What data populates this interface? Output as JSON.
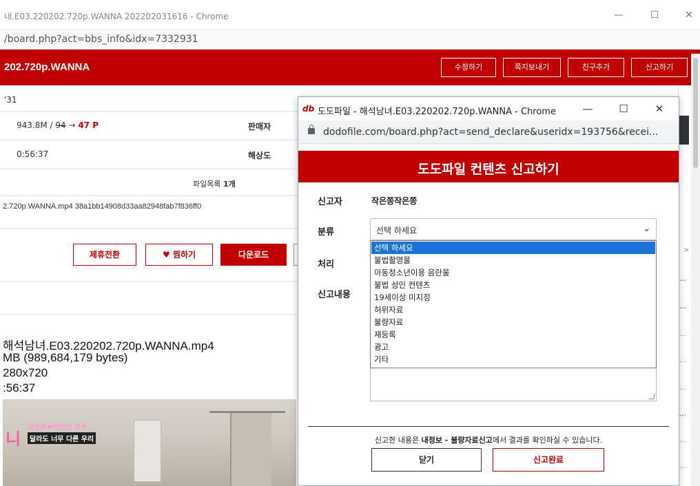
{
  "back": {
    "window_title": "내.E03.220202.720p.WANNA 202202031616 - Chrome",
    "window_controls": {
      "minimize": "—",
      "maximize": "☐",
      "close": "✕"
    },
    "url": "/board.php?act=bbs_info&idx=7332931",
    "header_name": "202.720p.WANNA",
    "header_buttons": [
      "수정하기",
      "쪽지보내기",
      "친구추가",
      "신고하기"
    ],
    "code": "'31",
    "info": {
      "size": "943.8M / ",
      "old_price": "94",
      "arrow": " → ",
      "new_price": "47 P",
      "seller_label": "판매자",
      "time": "0:56:37",
      "resolution_label": "해상도"
    },
    "filelist_label": "파일목록",
    "filelist_count": "1개",
    "file_line": "2.720p.WANNA.mp4 38a1bb14908d33aa82948fab7f836ff0",
    "actions": {
      "partner": "제휴전환",
      "like": "♥ 찜하기",
      "download": "다운로드"
    },
    "detail_lines": [
      "해석남녀.E03.220202.720p.WANNA.mp4",
      "MB (989,684,179 bytes)",
      "280x720",
      ":56:37"
    ],
    "thumb": {
      "caption1": "양준혁♥박현선 부부",
      "caption2": "달라도 너무 다른 우리",
      "logo_letter": "니"
    },
    "right_items": [
      ">",
      "...",
      "...",
      "...",
      "...",
      "...",
      "...",
      "...",
      "...",
      "..."
    ]
  },
  "popup": {
    "logo": "db",
    "title": "도도파일 - 해석남녀.E03.220202.720p.WANNA - Chrome",
    "controls": {
      "minimize": "—",
      "maximize": "☐",
      "close": "✕"
    },
    "url": "dodofile.com/board.php?act=send_declare&useridx=193756&recei...",
    "heading": "도도파일 컨텐츠 신고하기",
    "reporter_label": "신고자",
    "reporter_value": "작은쫑작은쫑",
    "category_label": "분류",
    "category_selected": "선택 하세요",
    "process_label": "처리",
    "content_label": "신고내용",
    "options": [
      "선택 하세요",
      "불법촬영물",
      "아동청소년이용 음란물",
      "불법 성인 컨텐츠",
      "19세이상 미지정",
      "허위자료",
      "불량자료",
      "재등록",
      "광고",
      "기타"
    ],
    "note_prefix": "신고한 내용은 ",
    "note_bold": "내정보 - 불량자료신고",
    "note_suffix": "에서 결과를 확인하실 수 있습니다.",
    "close_button": "닫기",
    "submit_button": "신고완료"
  },
  "colors": {
    "brand_red": "#c00000",
    "select_highlight": "#1e74d6"
  }
}
